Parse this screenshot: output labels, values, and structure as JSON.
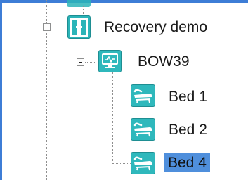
{
  "tree": {
    "group": {
      "label": "Recovery demo",
      "icon": "door-group-icon",
      "expanded": true
    },
    "device": {
      "label": "BOW39",
      "icon": "monitor-icon",
      "expanded": true
    },
    "beds": [
      {
        "label": "Bed 1",
        "icon": "bed-icon",
        "selected": false
      },
      {
        "label": "Bed 2",
        "icon": "bed-icon",
        "selected": false
      },
      {
        "label": "Bed 4",
        "icon": "bed-icon",
        "selected": true
      }
    ]
  },
  "colors": {
    "selection": "#4f8fdc",
    "icon_teal": "#2fb8bc",
    "frame": "#3d7dd6"
  }
}
